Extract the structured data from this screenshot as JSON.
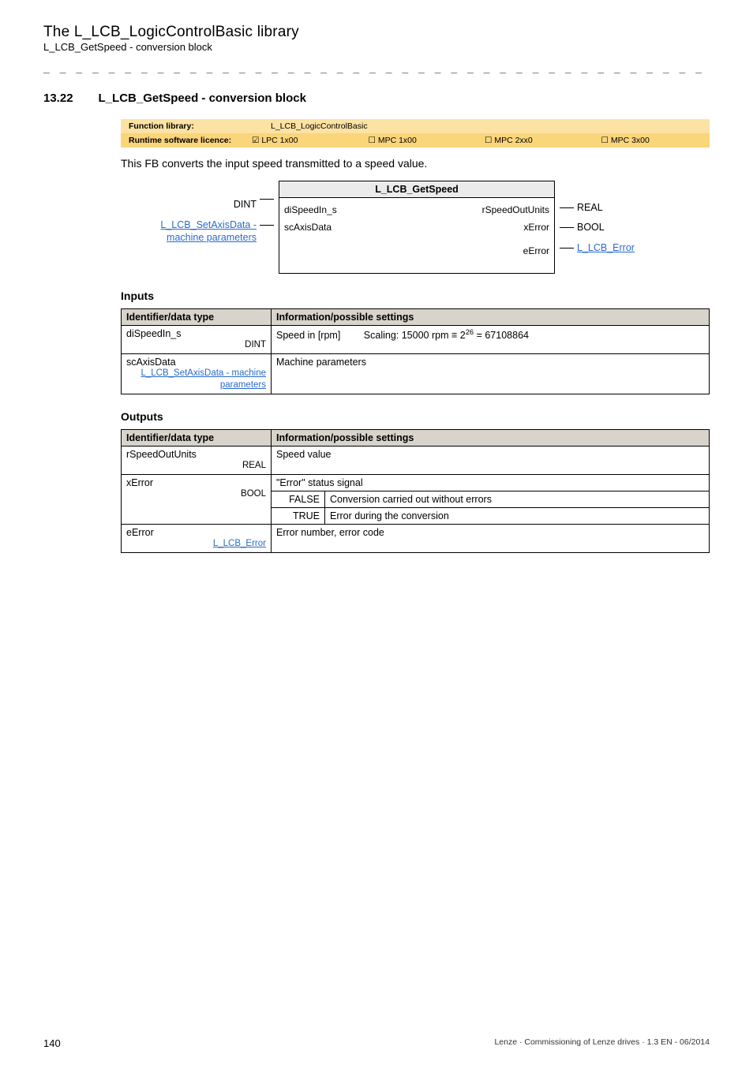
{
  "header": {
    "title": "The L_LCB_LogicControlBasic library",
    "subtitle": "L_LCB_GetSpeed - conversion block"
  },
  "section": {
    "number": "13.22",
    "title": "L_LCB_GetSpeed - conversion block"
  },
  "license_table": {
    "row1": {
      "label": "Function library:",
      "value": "L_LCB_LogicControlBasic"
    },
    "row2": {
      "label": "Runtime software licence:",
      "cells": {
        "c1_mark": "☑",
        "c1_label": "LPC 1x00",
        "c2_mark": "☐",
        "c2_label": "MPC 1x00",
        "c3_mark": "☐",
        "c3_label": "MPC 2xx0",
        "c4_mark": "☐",
        "c4_label": "MPC 3x00"
      }
    }
  },
  "description": "This FB converts the input speed transmitted to a speed value.",
  "diagram": {
    "block_title": "L_LCB_GetSpeed",
    "left_ext": {
      "r1": "DINT",
      "r2_link": "L_LCB_SetAxisData - machine parameters"
    },
    "ports": {
      "l1": "diSpeedIn_s",
      "l2": "scAxisData",
      "r1": "rSpeedOutUnits",
      "r2": "xError",
      "r3": "eError"
    },
    "right_ext": {
      "r1": "REAL",
      "r2": "BOOL",
      "r3_link": "L_LCB_Error"
    }
  },
  "inputs": {
    "heading": "Inputs",
    "th1": "Identifier/data type",
    "th2": "Information/possible settings",
    "rows": [
      {
        "id": "diSpeedIn_s",
        "type": "DINT",
        "info_prefix": "Speed in [rpm]",
        "info_scaling_prefix": "Scaling: 15000 rpm ≡ 2",
        "info_scaling_sup": "26",
        "info_scaling_suffix": " = 67108864"
      },
      {
        "id": "scAxisData",
        "sublink": "L_LCB_SetAxisData - machine parameters",
        "info": "Machine parameters"
      }
    ]
  },
  "outputs": {
    "heading": "Outputs",
    "th1": "Identifier/data type",
    "th2": "Information/possible settings",
    "rows": {
      "r1": {
        "id": "rSpeedOutUnits",
        "type": "REAL",
        "info": "Speed value"
      },
      "r2": {
        "id": "xError",
        "type": "BOOL",
        "top": "\"Error\" status signal",
        "false_label": "FALSE",
        "false_text": "Conversion carried out without errors",
        "true_label": "TRUE",
        "true_text": "Error during the conversion"
      },
      "r3": {
        "id": "eError",
        "link": "L_LCB_Error",
        "info": "Error number, error code"
      }
    }
  },
  "footer": {
    "page": "140",
    "right": "Lenze · Commissioning of Lenze drives · 1.3 EN - 06/2014"
  }
}
